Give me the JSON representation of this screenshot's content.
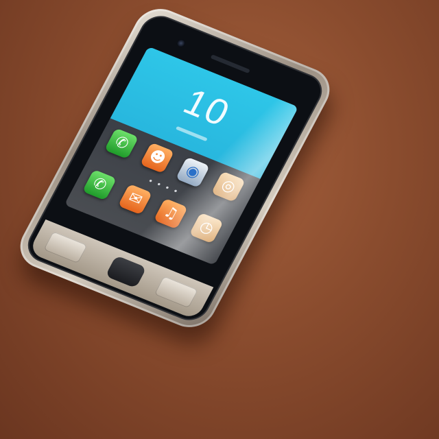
{
  "photo": {
    "subject": "smartphone",
    "background_color": "#8a4c2e",
    "body_color": "#c8bfb2"
  },
  "screen": {
    "widget_text": "10",
    "widget_color": "#2ec6e8",
    "page_indicator": "••••"
  },
  "app_icons": [
    {
      "icon": "phone-icon",
      "color": "#2f9e35"
    },
    {
      "icon": "contacts-icon",
      "color": "#e5641d"
    },
    {
      "icon": "camera-icon",
      "color": "#93a9c2"
    },
    {
      "icon": "browser-icon",
      "color": "#d59a58"
    },
    {
      "icon": "phone-icon",
      "color": "#2f9e35"
    },
    {
      "icon": "messages-icon",
      "color": "#e5641d"
    },
    {
      "icon": "music-icon",
      "color": "#e5641d"
    },
    {
      "icon": "clock-icon",
      "color": "#d59a58"
    }
  ]
}
